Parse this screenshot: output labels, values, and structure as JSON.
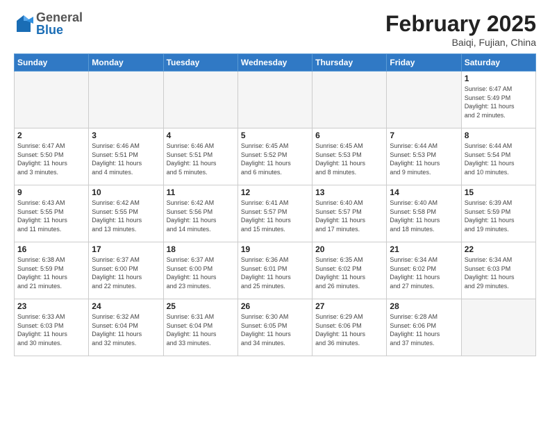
{
  "header": {
    "logo_general": "General",
    "logo_blue": "Blue",
    "month_title": "February 2025",
    "location": "Baiqi, Fujian, China"
  },
  "days_of_week": [
    "Sunday",
    "Monday",
    "Tuesday",
    "Wednesday",
    "Thursday",
    "Friday",
    "Saturday"
  ],
  "weeks": [
    [
      {
        "day": "",
        "info": ""
      },
      {
        "day": "",
        "info": ""
      },
      {
        "day": "",
        "info": ""
      },
      {
        "day": "",
        "info": ""
      },
      {
        "day": "",
        "info": ""
      },
      {
        "day": "",
        "info": ""
      },
      {
        "day": "1",
        "info": "Sunrise: 6:47 AM\nSunset: 5:49 PM\nDaylight: 11 hours\nand 2 minutes."
      }
    ],
    [
      {
        "day": "2",
        "info": "Sunrise: 6:47 AM\nSunset: 5:50 PM\nDaylight: 11 hours\nand 3 minutes."
      },
      {
        "day": "3",
        "info": "Sunrise: 6:46 AM\nSunset: 5:51 PM\nDaylight: 11 hours\nand 4 minutes."
      },
      {
        "day": "4",
        "info": "Sunrise: 6:46 AM\nSunset: 5:51 PM\nDaylight: 11 hours\nand 5 minutes."
      },
      {
        "day": "5",
        "info": "Sunrise: 6:45 AM\nSunset: 5:52 PM\nDaylight: 11 hours\nand 6 minutes."
      },
      {
        "day": "6",
        "info": "Sunrise: 6:45 AM\nSunset: 5:53 PM\nDaylight: 11 hours\nand 8 minutes."
      },
      {
        "day": "7",
        "info": "Sunrise: 6:44 AM\nSunset: 5:53 PM\nDaylight: 11 hours\nand 9 minutes."
      },
      {
        "day": "8",
        "info": "Sunrise: 6:44 AM\nSunset: 5:54 PM\nDaylight: 11 hours\nand 10 minutes."
      }
    ],
    [
      {
        "day": "9",
        "info": "Sunrise: 6:43 AM\nSunset: 5:55 PM\nDaylight: 11 hours\nand 11 minutes."
      },
      {
        "day": "10",
        "info": "Sunrise: 6:42 AM\nSunset: 5:55 PM\nDaylight: 11 hours\nand 13 minutes."
      },
      {
        "day": "11",
        "info": "Sunrise: 6:42 AM\nSunset: 5:56 PM\nDaylight: 11 hours\nand 14 minutes."
      },
      {
        "day": "12",
        "info": "Sunrise: 6:41 AM\nSunset: 5:57 PM\nDaylight: 11 hours\nand 15 minutes."
      },
      {
        "day": "13",
        "info": "Sunrise: 6:40 AM\nSunset: 5:57 PM\nDaylight: 11 hours\nand 17 minutes."
      },
      {
        "day": "14",
        "info": "Sunrise: 6:40 AM\nSunset: 5:58 PM\nDaylight: 11 hours\nand 18 minutes."
      },
      {
        "day": "15",
        "info": "Sunrise: 6:39 AM\nSunset: 5:59 PM\nDaylight: 11 hours\nand 19 minutes."
      }
    ],
    [
      {
        "day": "16",
        "info": "Sunrise: 6:38 AM\nSunset: 5:59 PM\nDaylight: 11 hours\nand 21 minutes."
      },
      {
        "day": "17",
        "info": "Sunrise: 6:37 AM\nSunset: 6:00 PM\nDaylight: 11 hours\nand 22 minutes."
      },
      {
        "day": "18",
        "info": "Sunrise: 6:37 AM\nSunset: 6:00 PM\nDaylight: 11 hours\nand 23 minutes."
      },
      {
        "day": "19",
        "info": "Sunrise: 6:36 AM\nSunset: 6:01 PM\nDaylight: 11 hours\nand 25 minutes."
      },
      {
        "day": "20",
        "info": "Sunrise: 6:35 AM\nSunset: 6:02 PM\nDaylight: 11 hours\nand 26 minutes."
      },
      {
        "day": "21",
        "info": "Sunrise: 6:34 AM\nSunset: 6:02 PM\nDaylight: 11 hours\nand 27 minutes."
      },
      {
        "day": "22",
        "info": "Sunrise: 6:34 AM\nSunset: 6:03 PM\nDaylight: 11 hours\nand 29 minutes."
      }
    ],
    [
      {
        "day": "23",
        "info": "Sunrise: 6:33 AM\nSunset: 6:03 PM\nDaylight: 11 hours\nand 30 minutes."
      },
      {
        "day": "24",
        "info": "Sunrise: 6:32 AM\nSunset: 6:04 PM\nDaylight: 11 hours\nand 32 minutes."
      },
      {
        "day": "25",
        "info": "Sunrise: 6:31 AM\nSunset: 6:04 PM\nDaylight: 11 hours\nand 33 minutes."
      },
      {
        "day": "26",
        "info": "Sunrise: 6:30 AM\nSunset: 6:05 PM\nDaylight: 11 hours\nand 34 minutes."
      },
      {
        "day": "27",
        "info": "Sunrise: 6:29 AM\nSunset: 6:06 PM\nDaylight: 11 hours\nand 36 minutes."
      },
      {
        "day": "28",
        "info": "Sunrise: 6:28 AM\nSunset: 6:06 PM\nDaylight: 11 hours\nand 37 minutes."
      },
      {
        "day": "",
        "info": ""
      }
    ]
  ]
}
